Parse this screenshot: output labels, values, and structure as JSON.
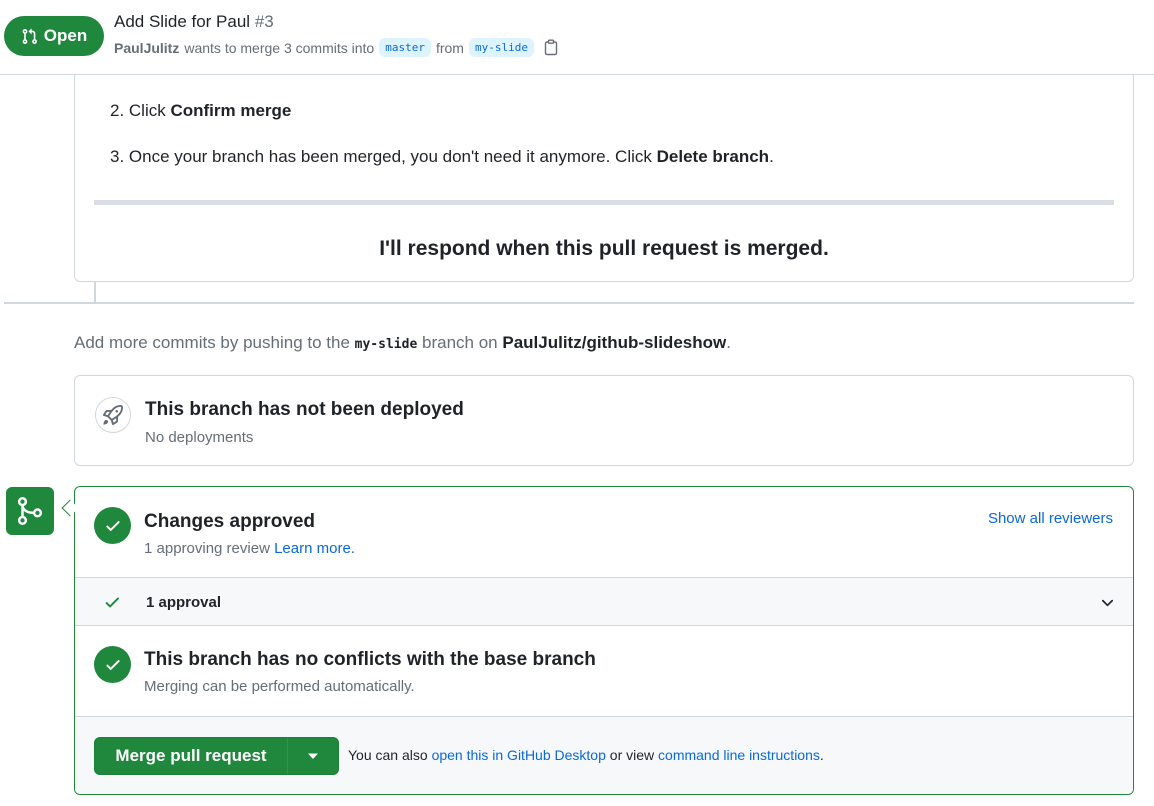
{
  "header": {
    "state": "Open",
    "title": "Add Slide for Paul",
    "number": "#3",
    "author": "PaulJulitz",
    "merge_text": "wants to merge 3 commits into",
    "base_branch": "master",
    "from_text": "from",
    "head_branch": "my-slide"
  },
  "comment": {
    "step2_prefix": "2. Click",
    "step2_bold": "Confirm merge",
    "step3_prefix": "3. Once your branch has been merged, you don't need it anymore. Click",
    "step3_bold": "Delete branch",
    "step3_suffix": ".",
    "respond": "I'll respond when this pull request is merged."
  },
  "push_note": {
    "prefix": "Add more commits by pushing to the",
    "branch": "my-slide",
    "middle": "branch on",
    "repo": "PaulJulitz/github-slideshow",
    "suffix": "."
  },
  "deployment": {
    "title": "This branch has not been deployed",
    "subtitle": "No deployments"
  },
  "merge_box": {
    "approved_title": "Changes approved",
    "approved_sub": "1 approving review",
    "learn_more": "Learn more.",
    "show_reviewers": "Show all reviewers",
    "approval_label": "1 approval",
    "conflicts_title": "This branch has no conflicts with the base branch",
    "conflicts_sub": "Merging can be performed automatically.",
    "merge_button": "Merge pull request",
    "note_prefix": "You can also",
    "desktop_link": "open this in GitHub Desktop",
    "note_middle": "or view",
    "cli_link": "command line instructions",
    "note_suffix": "."
  },
  "colors": {
    "success": "#1f883d",
    "link": "#0969da",
    "branch_tag_bg": "#ddf4ff"
  }
}
